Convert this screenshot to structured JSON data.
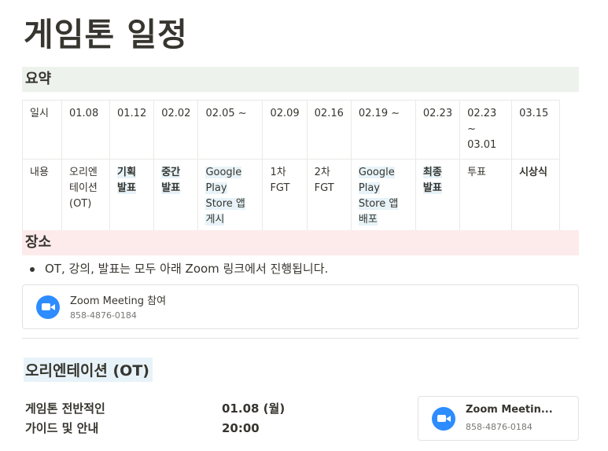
{
  "page_title": "게임톤 일정",
  "summary": {
    "heading": "요약",
    "row_labels": [
      "일시",
      "내용"
    ],
    "dates": [
      "01.08",
      "01.12",
      "02.02",
      "02.05 ~",
      "02.09",
      "02.16",
      "02.19 ~",
      "02.23",
      "02.23 ~ 03.01",
      "03.15"
    ],
    "contents": [
      "오리엔테이션 (OT)",
      "기획 발표",
      "중간 발표",
      "Google Play Store 앱 게시",
      "1차 FGT",
      "2차 FGT",
      "Google Play Store 앱 배포",
      "최종 발표",
      "투표",
      "시상식"
    ]
  },
  "place": {
    "heading": "장소",
    "bullet": "OT, 강의, 발표는 모두 아래 Zoom 링크에서 진행됩니다.",
    "zoom_link": {
      "title": "Zoom Meeting 참여",
      "meeting_id": "858-4876-0184"
    }
  },
  "ot": {
    "heading": "오리엔테이션 (OT)",
    "desc_line1": "게임톤 전반적인",
    "desc_line2": "가이드 및 안내",
    "date": "01.08 (월)",
    "time": "20:00",
    "zoom_link": {
      "title": "Zoom Meetin...",
      "meeting_id": "858-4876-0184"
    }
  },
  "colors": {
    "summary_bg": "#edf3ec",
    "place_bg": "#fdebec",
    "highlight_bg": "#e7f3f8",
    "zoom_blue": "#2d8cff"
  },
  "icons": {
    "zoom": "zoom-camera-icon",
    "bullet": "bullet-dot-icon"
  }
}
